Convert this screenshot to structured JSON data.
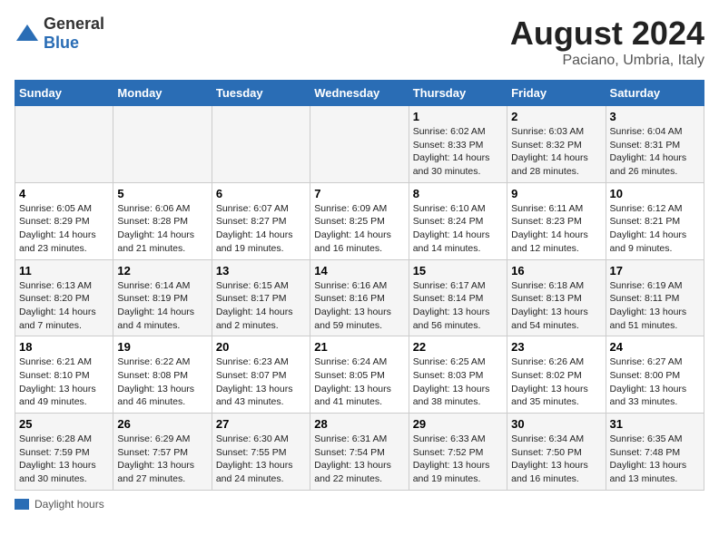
{
  "header": {
    "logo_general": "General",
    "logo_blue": "Blue",
    "main_title": "August 2024",
    "subtitle": "Paciano, Umbria, Italy"
  },
  "days_of_week": [
    "Sunday",
    "Monday",
    "Tuesday",
    "Wednesday",
    "Thursday",
    "Friday",
    "Saturday"
  ],
  "weeks": [
    [
      {
        "num": "",
        "info": ""
      },
      {
        "num": "",
        "info": ""
      },
      {
        "num": "",
        "info": ""
      },
      {
        "num": "",
        "info": ""
      },
      {
        "num": "1",
        "info": "Sunrise: 6:02 AM\nSunset: 8:33 PM\nDaylight: 14 hours and 30 minutes."
      },
      {
        "num": "2",
        "info": "Sunrise: 6:03 AM\nSunset: 8:32 PM\nDaylight: 14 hours and 28 minutes."
      },
      {
        "num": "3",
        "info": "Sunrise: 6:04 AM\nSunset: 8:31 PM\nDaylight: 14 hours and 26 minutes."
      }
    ],
    [
      {
        "num": "4",
        "info": "Sunrise: 6:05 AM\nSunset: 8:29 PM\nDaylight: 14 hours and 23 minutes."
      },
      {
        "num": "5",
        "info": "Sunrise: 6:06 AM\nSunset: 8:28 PM\nDaylight: 14 hours and 21 minutes."
      },
      {
        "num": "6",
        "info": "Sunrise: 6:07 AM\nSunset: 8:27 PM\nDaylight: 14 hours and 19 minutes."
      },
      {
        "num": "7",
        "info": "Sunrise: 6:09 AM\nSunset: 8:25 PM\nDaylight: 14 hours and 16 minutes."
      },
      {
        "num": "8",
        "info": "Sunrise: 6:10 AM\nSunset: 8:24 PM\nDaylight: 14 hours and 14 minutes."
      },
      {
        "num": "9",
        "info": "Sunrise: 6:11 AM\nSunset: 8:23 PM\nDaylight: 14 hours and 12 minutes."
      },
      {
        "num": "10",
        "info": "Sunrise: 6:12 AM\nSunset: 8:21 PM\nDaylight: 14 hours and 9 minutes."
      }
    ],
    [
      {
        "num": "11",
        "info": "Sunrise: 6:13 AM\nSunset: 8:20 PM\nDaylight: 14 hours and 7 minutes."
      },
      {
        "num": "12",
        "info": "Sunrise: 6:14 AM\nSunset: 8:19 PM\nDaylight: 14 hours and 4 minutes."
      },
      {
        "num": "13",
        "info": "Sunrise: 6:15 AM\nSunset: 8:17 PM\nDaylight: 14 hours and 2 minutes."
      },
      {
        "num": "14",
        "info": "Sunrise: 6:16 AM\nSunset: 8:16 PM\nDaylight: 13 hours and 59 minutes."
      },
      {
        "num": "15",
        "info": "Sunrise: 6:17 AM\nSunset: 8:14 PM\nDaylight: 13 hours and 56 minutes."
      },
      {
        "num": "16",
        "info": "Sunrise: 6:18 AM\nSunset: 8:13 PM\nDaylight: 13 hours and 54 minutes."
      },
      {
        "num": "17",
        "info": "Sunrise: 6:19 AM\nSunset: 8:11 PM\nDaylight: 13 hours and 51 minutes."
      }
    ],
    [
      {
        "num": "18",
        "info": "Sunrise: 6:21 AM\nSunset: 8:10 PM\nDaylight: 13 hours and 49 minutes."
      },
      {
        "num": "19",
        "info": "Sunrise: 6:22 AM\nSunset: 8:08 PM\nDaylight: 13 hours and 46 minutes."
      },
      {
        "num": "20",
        "info": "Sunrise: 6:23 AM\nSunset: 8:07 PM\nDaylight: 13 hours and 43 minutes."
      },
      {
        "num": "21",
        "info": "Sunrise: 6:24 AM\nSunset: 8:05 PM\nDaylight: 13 hours and 41 minutes."
      },
      {
        "num": "22",
        "info": "Sunrise: 6:25 AM\nSunset: 8:03 PM\nDaylight: 13 hours and 38 minutes."
      },
      {
        "num": "23",
        "info": "Sunrise: 6:26 AM\nSunset: 8:02 PM\nDaylight: 13 hours and 35 minutes."
      },
      {
        "num": "24",
        "info": "Sunrise: 6:27 AM\nSunset: 8:00 PM\nDaylight: 13 hours and 33 minutes."
      }
    ],
    [
      {
        "num": "25",
        "info": "Sunrise: 6:28 AM\nSunset: 7:59 PM\nDaylight: 13 hours and 30 minutes."
      },
      {
        "num": "26",
        "info": "Sunrise: 6:29 AM\nSunset: 7:57 PM\nDaylight: 13 hours and 27 minutes."
      },
      {
        "num": "27",
        "info": "Sunrise: 6:30 AM\nSunset: 7:55 PM\nDaylight: 13 hours and 24 minutes."
      },
      {
        "num": "28",
        "info": "Sunrise: 6:31 AM\nSunset: 7:54 PM\nDaylight: 13 hours and 22 minutes."
      },
      {
        "num": "29",
        "info": "Sunrise: 6:33 AM\nSunset: 7:52 PM\nDaylight: 13 hours and 19 minutes."
      },
      {
        "num": "30",
        "info": "Sunrise: 6:34 AM\nSunset: 7:50 PM\nDaylight: 13 hours and 16 minutes."
      },
      {
        "num": "31",
        "info": "Sunrise: 6:35 AM\nSunset: 7:48 PM\nDaylight: 13 hours and 13 minutes."
      }
    ]
  ],
  "footer": {
    "legend_label": "Daylight hours"
  }
}
